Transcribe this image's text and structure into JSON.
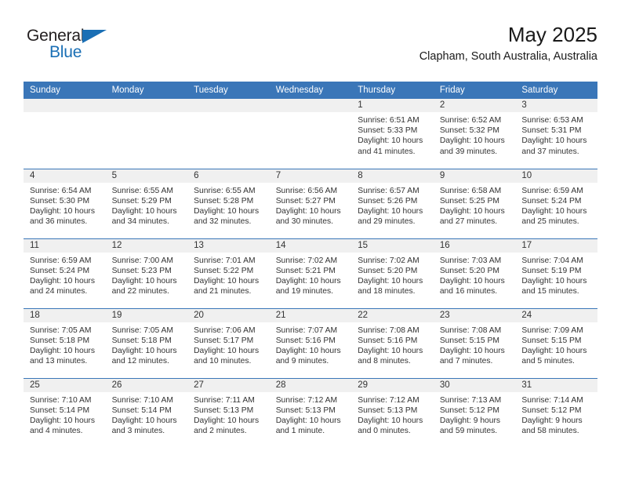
{
  "brand": {
    "name_top": "General",
    "name_bottom": "Blue",
    "triangle_color": "#1a6fb5"
  },
  "header": {
    "month_title": "May 2025",
    "location": "Clapham, South Australia, Australia"
  },
  "theme": {
    "header_blue": "#3a76b8",
    "daynum_band": "#f0f0f0",
    "text": "#333333"
  },
  "weekday_headers": [
    "Sunday",
    "Monday",
    "Tuesday",
    "Wednesday",
    "Thursday",
    "Friday",
    "Saturday"
  ],
  "labels": {
    "sunrise_prefix": "Sunrise:",
    "sunset_prefix": "Sunset:",
    "daylight_prefix": "Daylight:"
  },
  "weeks": [
    [
      {
        "day": "",
        "empty": true
      },
      {
        "day": "",
        "empty": true
      },
      {
        "day": "",
        "empty": true
      },
      {
        "day": "",
        "empty": true
      },
      {
        "day": "1",
        "sunrise": "Sunrise: 6:51 AM",
        "sunset": "Sunset: 5:33 PM",
        "daylight_line1": "Daylight: 10 hours",
        "daylight_line2": "and 41 minutes."
      },
      {
        "day": "2",
        "sunrise": "Sunrise: 6:52 AM",
        "sunset": "Sunset: 5:32 PM",
        "daylight_line1": "Daylight: 10 hours",
        "daylight_line2": "and 39 minutes."
      },
      {
        "day": "3",
        "sunrise": "Sunrise: 6:53 AM",
        "sunset": "Sunset: 5:31 PM",
        "daylight_line1": "Daylight: 10 hours",
        "daylight_line2": "and 37 minutes."
      }
    ],
    [
      {
        "day": "4",
        "sunrise": "Sunrise: 6:54 AM",
        "sunset": "Sunset: 5:30 PM",
        "daylight_line1": "Daylight: 10 hours",
        "daylight_line2": "and 36 minutes."
      },
      {
        "day": "5",
        "sunrise": "Sunrise: 6:55 AM",
        "sunset": "Sunset: 5:29 PM",
        "daylight_line1": "Daylight: 10 hours",
        "daylight_line2": "and 34 minutes."
      },
      {
        "day": "6",
        "sunrise": "Sunrise: 6:55 AM",
        "sunset": "Sunset: 5:28 PM",
        "daylight_line1": "Daylight: 10 hours",
        "daylight_line2": "and 32 minutes."
      },
      {
        "day": "7",
        "sunrise": "Sunrise: 6:56 AM",
        "sunset": "Sunset: 5:27 PM",
        "daylight_line1": "Daylight: 10 hours",
        "daylight_line2": "and 30 minutes."
      },
      {
        "day": "8",
        "sunrise": "Sunrise: 6:57 AM",
        "sunset": "Sunset: 5:26 PM",
        "daylight_line1": "Daylight: 10 hours",
        "daylight_line2": "and 29 minutes."
      },
      {
        "day": "9",
        "sunrise": "Sunrise: 6:58 AM",
        "sunset": "Sunset: 5:25 PM",
        "daylight_line1": "Daylight: 10 hours",
        "daylight_line2": "and 27 minutes."
      },
      {
        "day": "10",
        "sunrise": "Sunrise: 6:59 AM",
        "sunset": "Sunset: 5:24 PM",
        "daylight_line1": "Daylight: 10 hours",
        "daylight_line2": "and 25 minutes."
      }
    ],
    [
      {
        "day": "11",
        "sunrise": "Sunrise: 6:59 AM",
        "sunset": "Sunset: 5:24 PM",
        "daylight_line1": "Daylight: 10 hours",
        "daylight_line2": "and 24 minutes."
      },
      {
        "day": "12",
        "sunrise": "Sunrise: 7:00 AM",
        "sunset": "Sunset: 5:23 PM",
        "daylight_line1": "Daylight: 10 hours",
        "daylight_line2": "and 22 minutes."
      },
      {
        "day": "13",
        "sunrise": "Sunrise: 7:01 AM",
        "sunset": "Sunset: 5:22 PM",
        "daylight_line1": "Daylight: 10 hours",
        "daylight_line2": "and 21 minutes."
      },
      {
        "day": "14",
        "sunrise": "Sunrise: 7:02 AM",
        "sunset": "Sunset: 5:21 PM",
        "daylight_line1": "Daylight: 10 hours",
        "daylight_line2": "and 19 minutes."
      },
      {
        "day": "15",
        "sunrise": "Sunrise: 7:02 AM",
        "sunset": "Sunset: 5:20 PM",
        "daylight_line1": "Daylight: 10 hours",
        "daylight_line2": "and 18 minutes."
      },
      {
        "day": "16",
        "sunrise": "Sunrise: 7:03 AM",
        "sunset": "Sunset: 5:20 PM",
        "daylight_line1": "Daylight: 10 hours",
        "daylight_line2": "and 16 minutes."
      },
      {
        "day": "17",
        "sunrise": "Sunrise: 7:04 AM",
        "sunset": "Sunset: 5:19 PM",
        "daylight_line1": "Daylight: 10 hours",
        "daylight_line2": "and 15 minutes."
      }
    ],
    [
      {
        "day": "18",
        "sunrise": "Sunrise: 7:05 AM",
        "sunset": "Sunset: 5:18 PM",
        "daylight_line1": "Daylight: 10 hours",
        "daylight_line2": "and 13 minutes."
      },
      {
        "day": "19",
        "sunrise": "Sunrise: 7:05 AM",
        "sunset": "Sunset: 5:18 PM",
        "daylight_line1": "Daylight: 10 hours",
        "daylight_line2": "and 12 minutes."
      },
      {
        "day": "20",
        "sunrise": "Sunrise: 7:06 AM",
        "sunset": "Sunset: 5:17 PM",
        "daylight_line1": "Daylight: 10 hours",
        "daylight_line2": "and 10 minutes."
      },
      {
        "day": "21",
        "sunrise": "Sunrise: 7:07 AM",
        "sunset": "Sunset: 5:16 PM",
        "daylight_line1": "Daylight: 10 hours",
        "daylight_line2": "and 9 minutes."
      },
      {
        "day": "22",
        "sunrise": "Sunrise: 7:08 AM",
        "sunset": "Sunset: 5:16 PM",
        "daylight_line1": "Daylight: 10 hours",
        "daylight_line2": "and 8 minutes."
      },
      {
        "day": "23",
        "sunrise": "Sunrise: 7:08 AM",
        "sunset": "Sunset: 5:15 PM",
        "daylight_line1": "Daylight: 10 hours",
        "daylight_line2": "and 7 minutes."
      },
      {
        "day": "24",
        "sunrise": "Sunrise: 7:09 AM",
        "sunset": "Sunset: 5:15 PM",
        "daylight_line1": "Daylight: 10 hours",
        "daylight_line2": "and 5 minutes."
      }
    ],
    [
      {
        "day": "25",
        "sunrise": "Sunrise: 7:10 AM",
        "sunset": "Sunset: 5:14 PM",
        "daylight_line1": "Daylight: 10 hours",
        "daylight_line2": "and 4 minutes."
      },
      {
        "day": "26",
        "sunrise": "Sunrise: 7:10 AM",
        "sunset": "Sunset: 5:14 PM",
        "daylight_line1": "Daylight: 10 hours",
        "daylight_line2": "and 3 minutes."
      },
      {
        "day": "27",
        "sunrise": "Sunrise: 7:11 AM",
        "sunset": "Sunset: 5:13 PM",
        "daylight_line1": "Daylight: 10 hours",
        "daylight_line2": "and 2 minutes."
      },
      {
        "day": "28",
        "sunrise": "Sunrise: 7:12 AM",
        "sunset": "Sunset: 5:13 PM",
        "daylight_line1": "Daylight: 10 hours",
        "daylight_line2": "and 1 minute."
      },
      {
        "day": "29",
        "sunrise": "Sunrise: 7:12 AM",
        "sunset": "Sunset: 5:13 PM",
        "daylight_line1": "Daylight: 10 hours",
        "daylight_line2": "and 0 minutes."
      },
      {
        "day": "30",
        "sunrise": "Sunrise: 7:13 AM",
        "sunset": "Sunset: 5:12 PM",
        "daylight_line1": "Daylight: 9 hours",
        "daylight_line2": "and 59 minutes."
      },
      {
        "day": "31",
        "sunrise": "Sunrise: 7:14 AM",
        "sunset": "Sunset: 5:12 PM",
        "daylight_line1": "Daylight: 9 hours",
        "daylight_line2": "and 58 minutes."
      }
    ]
  ]
}
